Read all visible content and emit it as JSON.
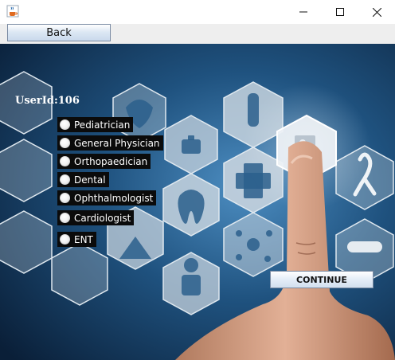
{
  "window": {
    "app_icon": "java-coffee-icon",
    "controls": [
      "minimize-icon",
      "maximize-icon",
      "close-icon"
    ]
  },
  "toolbar": {
    "back_label": "Back"
  },
  "main": {
    "user_id_label": "UserId:106",
    "specialties": [
      {
        "label": "Pediatrician",
        "selected": false
      },
      {
        "label": "General Physician",
        "selected": false
      },
      {
        "label": "Orthopaedician",
        "selected": false
      },
      {
        "label": "Dental",
        "selected": false
      },
      {
        "label": "Ophthalmologist",
        "selected": false
      },
      {
        "label": "Cardiologist",
        "selected": false
      },
      {
        "label": "ENT",
        "selected": false
      }
    ],
    "continue_label": "CONTINUE"
  },
  "colors": {
    "background_dark": "#0d2a4a",
    "background_mid": "#2f6d9e",
    "hex_tile": "#cfd9e2",
    "label_bg": "#0b0b0b",
    "label_text": "#ffffff"
  }
}
